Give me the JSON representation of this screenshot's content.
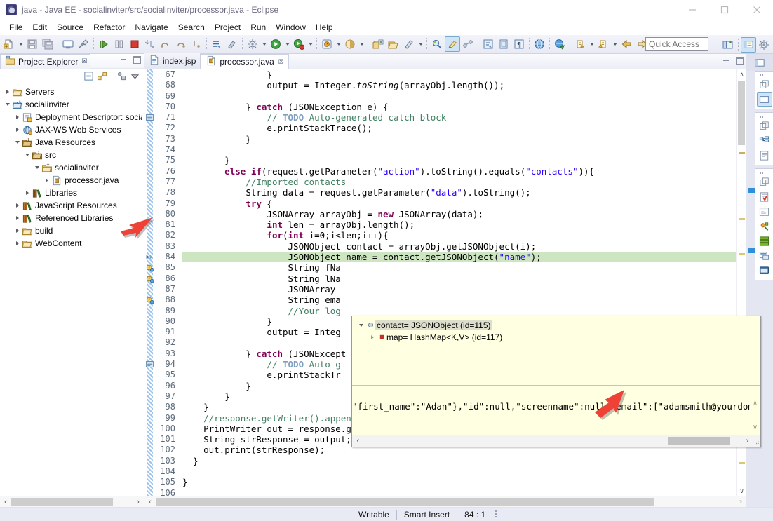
{
  "window": {
    "title": "java - Java EE - socialinviter/src/socialinviter/processor.java - Eclipse",
    "app_icon": "eclipse-icon",
    "minimize_label": "–",
    "maximize_label": "□",
    "close_label": "✕"
  },
  "menubar": {
    "items": [
      "File",
      "Edit",
      "Source",
      "Refactor",
      "Navigate",
      "Search",
      "Project",
      "Run",
      "Window",
      "Help"
    ]
  },
  "toolbar": {
    "quick_access_placeholder": "Quick Access"
  },
  "explorer": {
    "tab_label": "Project Explorer",
    "close_mark": "☒",
    "tree": [
      {
        "label": "Servers",
        "indent": 0,
        "twisty": "collapsed",
        "icon": "folder-icon"
      },
      {
        "label": "socialinviter",
        "indent": 0,
        "twisty": "expanded",
        "icon": "project-icon"
      },
      {
        "label": "Deployment Descriptor: social",
        "indent": 1,
        "twisty": "collapsed",
        "icon": "deployment-descriptor-icon"
      },
      {
        "label": "JAX-WS Web Services",
        "indent": 1,
        "twisty": "collapsed",
        "icon": "webservice-icon"
      },
      {
        "label": "Java Resources",
        "indent": 1,
        "twisty": "expanded",
        "icon": "java-resources-icon"
      },
      {
        "label": "src",
        "indent": 2,
        "twisty": "expanded",
        "icon": "source-folder-icon"
      },
      {
        "label": "socialinviter",
        "indent": 3,
        "twisty": "expanded",
        "icon": "package-icon"
      },
      {
        "label": "processor.java",
        "indent": 4,
        "twisty": "collapsed",
        "icon": "java-file-icon"
      },
      {
        "label": "Libraries",
        "indent": 2,
        "twisty": "collapsed",
        "icon": "library-icon"
      },
      {
        "label": "JavaScript Resources",
        "indent": 1,
        "twisty": "collapsed",
        "icon": "library-icon"
      },
      {
        "label": "Referenced Libraries",
        "indent": 1,
        "twisty": "collapsed",
        "icon": "library-icon"
      },
      {
        "label": "build",
        "indent": 1,
        "twisty": "collapsed",
        "icon": "folder-icon"
      },
      {
        "label": "WebContent",
        "indent": 1,
        "twisty": "collapsed",
        "icon": "folder-icon"
      }
    ]
  },
  "editor": {
    "tabs": [
      {
        "label": "index.jsp",
        "icon": "jsp-file-icon",
        "active": false,
        "closable": false
      },
      {
        "label": "processor.java",
        "icon": "java-file-icon",
        "active": true,
        "closable": true
      }
    ],
    "close_mark": "☒",
    "first_line": 67,
    "highlight_line": 84,
    "lines": [
      {
        "n": 67,
        "tokens": [
          {
            "t": "                ",
            "c": "plain"
          },
          {
            "t": "}",
            "c": "plain"
          }
        ]
      },
      {
        "n": 68,
        "tokens": [
          {
            "t": "                ",
            "c": "plain"
          },
          {
            "t": "output",
            "c": "plain"
          },
          {
            "t": " = ",
            "c": "plain"
          },
          {
            "t": "Integer",
            "c": "plain"
          },
          {
            "t": ".",
            "c": "plain"
          },
          {
            "t": "toString",
            "c": "static"
          },
          {
            "t": "(arrayObj.length());",
            "c": "plain"
          }
        ]
      },
      {
        "n": 69,
        "tokens": [
          {
            "t": "",
            "c": "plain"
          }
        ]
      },
      {
        "n": 70,
        "tokens": [
          {
            "t": "            } ",
            "c": "plain"
          },
          {
            "t": "catch",
            "c": "kw"
          },
          {
            "t": " (JSONException e) {",
            "c": "plain"
          }
        ]
      },
      {
        "n": 71,
        "tokens": [
          {
            "t": "                ",
            "c": "plain"
          },
          {
            "t": "// ",
            "c": "com"
          },
          {
            "t": "TODO",
            "c": "task"
          },
          {
            "t": " Auto-generated catch block",
            "c": "com"
          }
        ]
      },
      {
        "n": 72,
        "tokens": [
          {
            "t": "                e.printStackTrace();",
            "c": "plain"
          }
        ]
      },
      {
        "n": 73,
        "tokens": [
          {
            "t": "            }",
            "c": "plain"
          }
        ]
      },
      {
        "n": 74,
        "tokens": [
          {
            "t": "",
            "c": "plain"
          }
        ]
      },
      {
        "n": 75,
        "tokens": [
          {
            "t": "        }",
            "c": "plain"
          }
        ]
      },
      {
        "n": 76,
        "tokens": [
          {
            "t": "        ",
            "c": "plain"
          },
          {
            "t": "else if",
            "c": "kw"
          },
          {
            "t": "(request.getParameter(",
            "c": "plain"
          },
          {
            "t": "\"action\"",
            "c": "str"
          },
          {
            "t": ").toString().equals(",
            "c": "plain"
          },
          {
            "t": "\"contacts\"",
            "c": "str"
          },
          {
            "t": ")){",
            "c": "plain"
          }
        ]
      },
      {
        "n": 77,
        "tokens": [
          {
            "t": "            ",
            "c": "plain"
          },
          {
            "t": "//Imported contacts",
            "c": "com"
          }
        ]
      },
      {
        "n": 78,
        "tokens": [
          {
            "t": "            ",
            "c": "plain"
          },
          {
            "t": "String",
            "c": "plain"
          },
          {
            "t": " data = request.getParameter(",
            "c": "plain"
          },
          {
            "t": "\"data\"",
            "c": "str"
          },
          {
            "t": ").toString();",
            "c": "plain"
          }
        ]
      },
      {
        "n": 79,
        "tokens": [
          {
            "t": "            ",
            "c": "plain"
          },
          {
            "t": "try",
            "c": "kw"
          },
          {
            "t": " {",
            "c": "plain"
          }
        ]
      },
      {
        "n": 80,
        "tokens": [
          {
            "t": "                JSONArray arrayObj = ",
            "c": "plain"
          },
          {
            "t": "new",
            "c": "kw"
          },
          {
            "t": " JSONArray(data);",
            "c": "plain"
          }
        ]
      },
      {
        "n": 81,
        "tokens": [
          {
            "t": "                ",
            "c": "plain"
          },
          {
            "t": "int",
            "c": "kw"
          },
          {
            "t": " len = arrayObj.length();",
            "c": "plain"
          }
        ]
      },
      {
        "n": 82,
        "tokens": [
          {
            "t": "                ",
            "c": "plain"
          },
          {
            "t": "for",
            "c": "kw"
          },
          {
            "t": "(",
            "c": "plain"
          },
          {
            "t": "int",
            "c": "kw"
          },
          {
            "t": " i=0;i<len;i++){",
            "c": "plain"
          }
        ]
      },
      {
        "n": 83,
        "tokens": [
          {
            "t": "                    JSONObject contact = arrayObj.getJSONObject(i);",
            "c": "plain"
          }
        ]
      },
      {
        "n": 84,
        "tokens": [
          {
            "t": "                    JSONObject name = contact.getJSONObject(",
            "c": "plain"
          },
          {
            "t": "\"name\"",
            "c": "str"
          },
          {
            "t": ");",
            "c": "plain"
          }
        ]
      },
      {
        "n": 85,
        "tokens": [
          {
            "t": "                    ",
            "c": "plain"
          },
          {
            "t": "String",
            "c": "plain"
          },
          {
            "t": " fNa",
            "c": "plain"
          }
        ]
      },
      {
        "n": 86,
        "tokens": [
          {
            "t": "                    ",
            "c": "plain"
          },
          {
            "t": "String",
            "c": "plain"
          },
          {
            "t": " lNa",
            "c": "plain"
          }
        ]
      },
      {
        "n": 87,
        "tokens": [
          {
            "t": "                    JSONArray ",
            "c": "plain"
          }
        ]
      },
      {
        "n": 88,
        "tokens": [
          {
            "t": "                    ",
            "c": "plain"
          },
          {
            "t": "String",
            "c": "plain"
          },
          {
            "t": " ema",
            "c": "plain"
          }
        ]
      },
      {
        "n": 89,
        "tokens": [
          {
            "t": "                    ",
            "c": "plain"
          },
          {
            "t": "//Your log",
            "c": "com"
          }
        ]
      },
      {
        "n": 90,
        "tokens": [
          {
            "t": "                }",
            "c": "plain"
          }
        ]
      },
      {
        "n": 91,
        "tokens": [
          {
            "t": "                output = Integ",
            "c": "plain"
          }
        ]
      },
      {
        "n": 92,
        "tokens": [
          {
            "t": "",
            "c": "plain"
          }
        ]
      },
      {
        "n": 93,
        "tokens": [
          {
            "t": "            } ",
            "c": "plain"
          },
          {
            "t": "catch",
            "c": "kw"
          },
          {
            "t": " (JSONExcept",
            "c": "plain"
          }
        ]
      },
      {
        "n": 94,
        "tokens": [
          {
            "t": "                ",
            "c": "plain"
          },
          {
            "t": "// ",
            "c": "com"
          },
          {
            "t": "TODO",
            "c": "task"
          },
          {
            "t": " Auto-g",
            "c": "com"
          }
        ]
      },
      {
        "n": 95,
        "tokens": [
          {
            "t": "                e.printStackTr",
            "c": "plain"
          }
        ]
      },
      {
        "n": 96,
        "tokens": [
          {
            "t": "            }",
            "c": "plain"
          }
        ]
      },
      {
        "n": 97,
        "tokens": [
          {
            "t": "        }",
            "c": "plain"
          }
        ]
      },
      {
        "n": 98,
        "tokens": [
          {
            "t": "    }",
            "c": "plain"
          }
        ]
      },
      {
        "n": 99,
        "tokens": [
          {
            "t": "    ",
            "c": "plain"
          },
          {
            "t": "//response.getWriter().append(\"Served at: \").append(request.getContextPath());",
            "c": "com"
          }
        ]
      },
      {
        "n": 100,
        "tokens": [
          {
            "t": "    ",
            "c": "plain"
          },
          {
            "t": "PrintWriter",
            "c": "plain"
          },
          {
            "t": " out = response.getWriter();",
            "c": "plain"
          }
        ]
      },
      {
        "n": 101,
        "tokens": [
          {
            "t": "    ",
            "c": "plain"
          },
          {
            "t": "String",
            "c": "plain"
          },
          {
            "t": " strResponse = output;",
            "c": "plain"
          }
        ]
      },
      {
        "n": 102,
        "tokens": [
          {
            "t": "    out.print(strResponse);",
            "c": "plain"
          }
        ]
      },
      {
        "n": 103,
        "tokens": [
          {
            "t": "  }",
            "c": "plain"
          }
        ]
      },
      {
        "n": 104,
        "tokens": [
          {
            "t": "",
            "c": "plain"
          }
        ]
      },
      {
        "n": 105,
        "tokens": [
          {
            "t": "}",
            "c": "plain"
          }
        ]
      },
      {
        "n": 106,
        "tokens": [
          {
            "t": "",
            "c": "plain"
          }
        ]
      }
    ],
    "gutter_markers": [
      {
        "line": 71,
        "icon": "task-marker-icon"
      },
      {
        "line": 84,
        "icon": "debug-current-line-icon"
      },
      {
        "line": 85,
        "icon": "warning-marker-icon"
      },
      {
        "line": 86,
        "icon": "warning-marker-icon"
      },
      {
        "line": 88,
        "icon": "warning-marker-icon"
      },
      {
        "line": 94,
        "icon": "task-marker-icon"
      }
    ]
  },
  "popup": {
    "title_icon": "variable-icon",
    "tree": [
      {
        "label": "contact= JSONObject  (id=115)",
        "indent": 0,
        "twisty": "expanded",
        "marker": "object-marker",
        "selected": true
      },
      {
        "label": "map= HashMap<K,V>  (id=117)",
        "indent": 1,
        "twisty": "collapsed",
        "marker": "field-marker",
        "selected": false
      }
    ],
    "detail_text": "\"first_name\":\"Adan\"},\"id\":null,\"screenname\":null,\"email\":[\"adamsmith@yourdomain.",
    "scroll_left_label": "‹",
    "scroll_right_label": "›",
    "scroll_up_label": "∧",
    "scroll_down_label": "∨"
  },
  "statusbar": {
    "writable": "Writable",
    "insert_mode": "Smart Insert",
    "cursor_position": "84 : 1"
  },
  "scrollbars": {
    "left_arrow": "‹",
    "right_arrow": "›",
    "up_arrow": "∧",
    "down_arrow": "∨"
  },
  "colors": {
    "keyword": "#7f0055",
    "string": "#2a00ff",
    "comment": "#3f7f5f",
    "task_tag": "#7f9fbf",
    "highlight_line": "#cde5c0",
    "popup_bg": "#ffffe1",
    "annotation_arrow": "#ef4136",
    "toolbar_bg": "#eceef6"
  }
}
